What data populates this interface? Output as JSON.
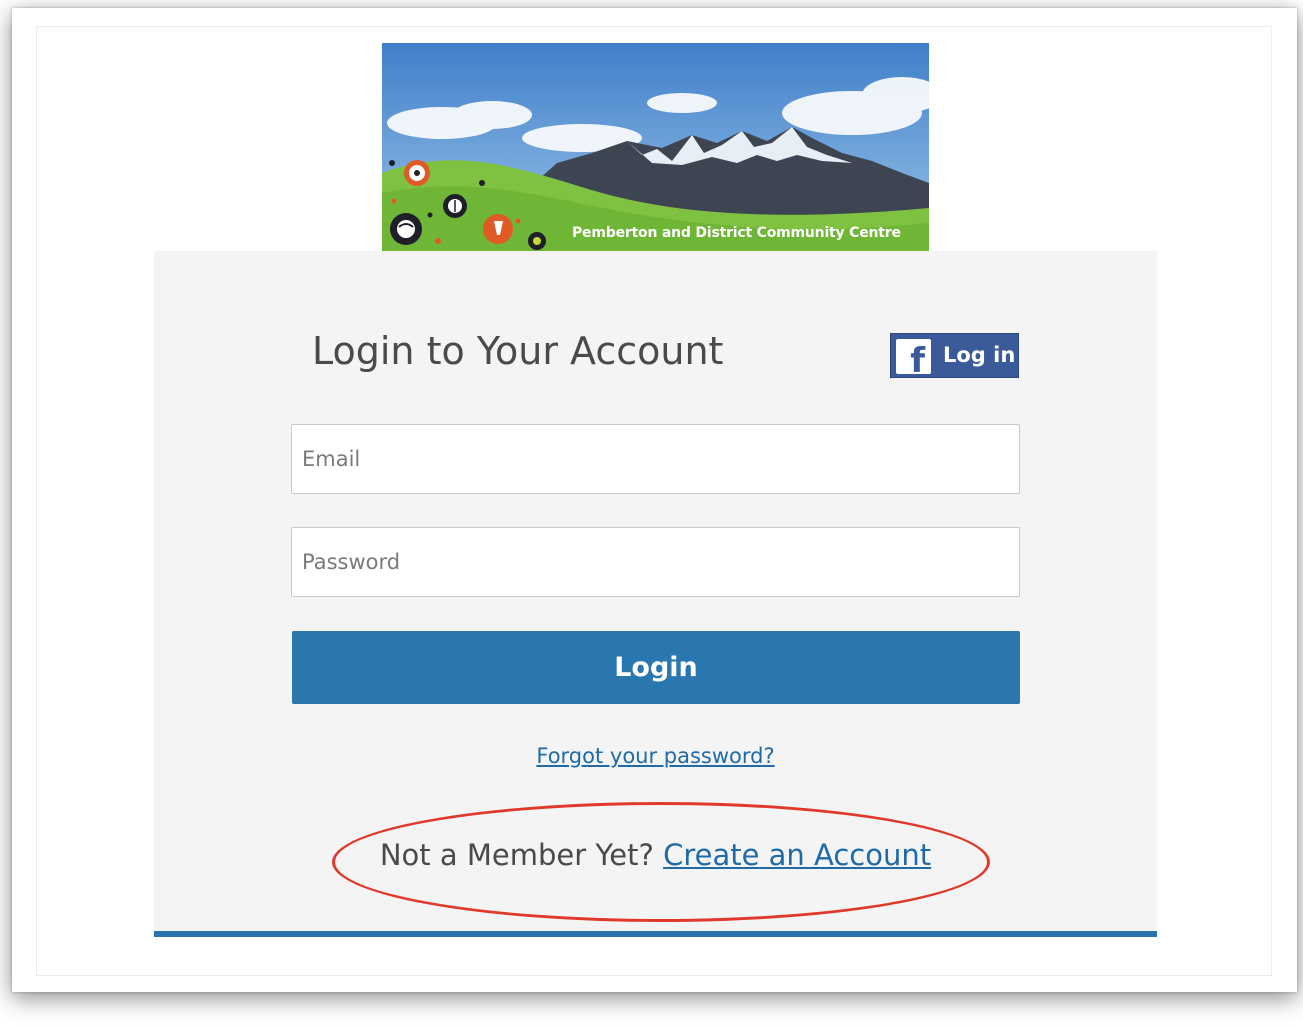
{
  "banner": {
    "caption": "Pemberton and District Community Centre"
  },
  "login": {
    "title": "Login to Your Account",
    "facebook_button_label": "Log in",
    "facebook_logo_glyph": "f",
    "email_placeholder": "Email",
    "password_placeholder": "Password",
    "submit_label": "Login",
    "forgot_password_label": "Forgot your password?",
    "signup_prompt": "Not a Member Yet?",
    "create_account_label": "Create an Account"
  },
  "colors": {
    "panel_background": "#f4f4f4",
    "primary_button": "#2a76af",
    "link": "#1f6aa8",
    "facebook_blue": "#3b5a99",
    "annotation_red": "#e0392b"
  },
  "icons": [
    "facebook-icon",
    "soccer-ball-icon",
    "baseball-icon",
    "volleyball-icon",
    "badminton-shuttlecock-icon",
    "tennis-ball-icon"
  ]
}
